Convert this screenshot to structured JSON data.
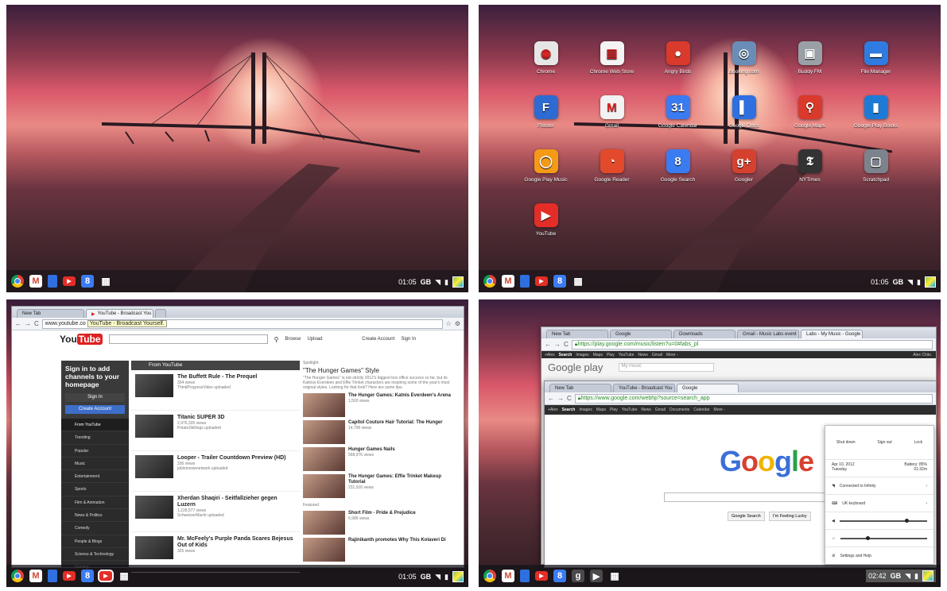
{
  "panels": {
    "status": {
      "time_a": "01:05",
      "time_b": "02:42",
      "net": "GB"
    },
    "launcher_apps": [
      {
        "label": "Chrome",
        "icon": "chrome-icon",
        "color": "#e6e6e6"
      },
      {
        "label": "Chrome Web Store",
        "icon": "web-store-icon",
        "color": "#f4f4f4"
      },
      {
        "label": "Angry Birds",
        "icon": "angry-birds-icon",
        "color": "#d93a2b"
      },
      {
        "label": "Booking.com",
        "icon": "booking-icon",
        "color": "#6a8db8"
      },
      {
        "label": "Buddy FM",
        "icon": "radio-icon",
        "color": "#9aa0a6"
      },
      {
        "label": "File Manager",
        "icon": "folder-icon",
        "color": "#2f7be0"
      },
      {
        "label": "Flixster",
        "icon": "flixster-icon",
        "color": "#2d6ad1"
      },
      {
        "label": "Gmail",
        "icon": "gmail-icon",
        "color": "#f2f2f2"
      },
      {
        "label": "Google Calendar",
        "icon": "calendar-icon",
        "color": "#3b7bf2"
      },
      {
        "label": "Google Docs",
        "icon": "docs-icon",
        "color": "#2f6fe0"
      },
      {
        "label": "Google Maps",
        "icon": "maps-pin-icon",
        "color": "#d93a2b"
      },
      {
        "label": "Google Play Books",
        "icon": "play-books-icon",
        "color": "#1d7bd6"
      },
      {
        "label": "Google Play Music",
        "icon": "headphones-icon",
        "color": "#f59a16"
      },
      {
        "label": "Google Reader",
        "icon": "rss-icon",
        "color": "#e34a2b"
      },
      {
        "label": "Google Search",
        "icon": "search-icon",
        "color": "#3b7bf2"
      },
      {
        "label": "Googler",
        "icon": "google-plus-icon",
        "color": "#d6412f"
      },
      {
        "label": "NYTimes",
        "icon": "nytimes-icon",
        "color": "#333333"
      },
      {
        "label": "Scratchpad",
        "icon": "scratchpad-icon",
        "color": "#7d838c"
      },
      {
        "label": "YouTube",
        "icon": "youtube-icon",
        "color": "#e52d27"
      }
    ],
    "app_glyphs": [
      "◉",
      "▤",
      "●",
      "◎",
      "▣",
      "▬",
      "F",
      "M",
      "31",
      "▌",
      "⚲",
      "▮",
      "◯",
      "◔",
      "8",
      "g+",
      "𝕿",
      "▢",
      "▶"
    ],
    "browser": {
      "tab1": "New Tab",
      "tab2": "YouTube - Broadcast You",
      "url": "www.youtube.co",
      "tooltip": "YouTube - Broadcast Yourself.",
      "yt": {
        "logo_you": "You",
        "logo_tube": "Tube",
        "nav": [
          "Browse",
          "Upload",
          "Create Account",
          "Sign In"
        ],
        "signin_text": "Sign in to add channels to your homepage",
        "signin_btn": "Sign In",
        "create_btn": "Create Account",
        "categories": [
          "From YouTube",
          "Trending",
          "Popular",
          "Music",
          "Entertainment",
          "Sports",
          "Film & Animation",
          "News & Politics",
          "Comedy",
          "People & Blogs",
          "Science & Technology",
          "Gaming"
        ],
        "feed_title": "From YouTube",
        "videos": [
          {
            "title": "The Buffett Rule - The Prequel",
            "meta": "304 views",
            "by": "ThinkProgressVideo uploaded"
          },
          {
            "title": "Titanic SUPER 3D",
            "meta": "2,976,335 views",
            "by": "PotatoSkillings uploaded"
          },
          {
            "title": "Looper - Trailer Countdown Preview (HD)",
            "meta": "336 views",
            "by": "joblomovienetwork uploaded"
          },
          {
            "title": "Xherdan Shaqiri - Seitfallzieher gegen Luzern",
            "meta": "1,226,577 views",
            "by": "SchweizerMacht uploaded"
          },
          {
            "title": "Mr. McFeely's Purple Panda Scares Bejesus Out of Kids",
            "meta": "325 views",
            "by": ""
          }
        ],
        "spotlight_label": "Spotlight",
        "spotlight_title": "\"The Hunger Games\" Style",
        "spotlight_desc": "\"The Hunger Games\" is not strictly 2012's biggest box office success so far, but its Katniss Everdeen and Effie Trinket characters are inspiring some of the year's most original styles. Looking for that look? Here are some tips.",
        "side": [
          {
            "title": "The Hunger Games: Katnis Everdeen's Arena",
            "meta": "1,503 views"
          },
          {
            "title": "Capitol Couture Hair Tutorial: The Hunger",
            "meta": "14,790 views"
          },
          {
            "title": "Hunger Games Nails",
            "meta": "568,976 views"
          },
          {
            "title": "The Hunger Games: Effie Trinket Makeup Tutorial",
            "meta": "231,916 views"
          }
        ],
        "featured_label": "Featured",
        "featured": [
          {
            "title": "Short Film - Pride & Prejudice",
            "meta": "6,986 views"
          },
          {
            "title": "Rajinikanth promotes Why This Kolaveri Di",
            "meta": ""
          }
        ]
      }
    },
    "play": {
      "tabs": [
        "New Tab",
        "Google",
        "Downloads",
        "Gmail - Music Labs event",
        "Labs - My Music - Google"
      ],
      "url": "https://play.google.com/music/listen?u=0#labs_pl",
      "bar": [
        "+Alex",
        "Search",
        "Images",
        "Maps",
        "Play",
        "YouTube",
        "News",
        "Gmail",
        "More -"
      ],
      "user": "Alex Chitu",
      "logo": "Google play",
      "search_ph": "My music"
    },
    "google": {
      "tabs": [
        "New Tab",
        "YouTube - Broadcast You",
        "Google"
      ],
      "url": "https://www.google.com/webhp?source=search_app",
      "bar": [
        "+Alex",
        "Search",
        "Images",
        "Maps",
        "Play",
        "YouTube",
        "News",
        "Gmail",
        "Documents",
        "Calendar",
        "More -"
      ],
      "btn1": "Google Search",
      "btn2": "I'm Feeling Lucky"
    },
    "menu": {
      "shutdown": "Shut down",
      "signout": "Sign out",
      "lock": "Lock",
      "date": "Apr 10, 2012",
      "day": "Tuesday",
      "battery": "Battery: 85%",
      "remaining": "01:32m",
      "wifi": "Connected to Infinity",
      "keyboard": "UK keyboard",
      "settings": "Settings and Help",
      "volume": 0.75,
      "brightness": 0.3
    }
  }
}
